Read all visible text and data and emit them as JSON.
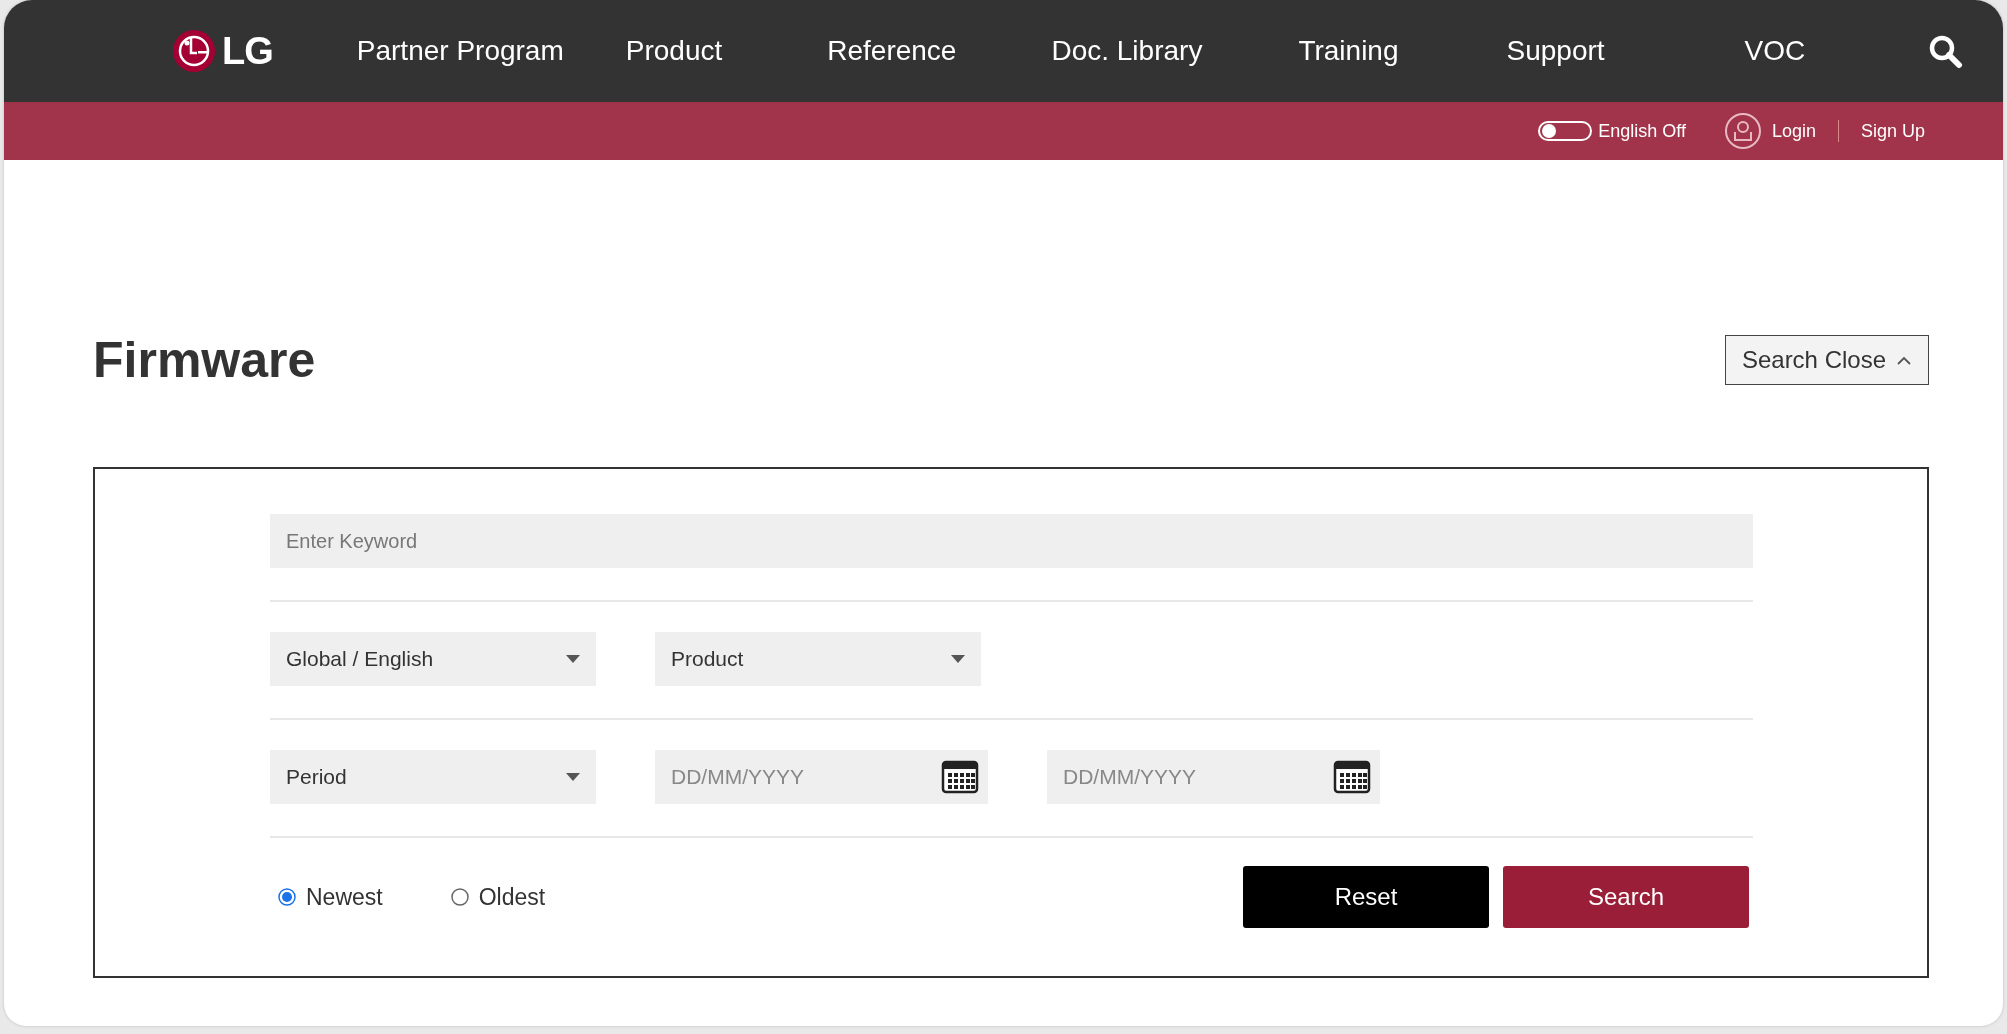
{
  "header": {
    "logo": "LG",
    "nav": [
      {
        "label": "Partner Program"
      },
      {
        "label": "Product"
      },
      {
        "label": "Reference"
      },
      {
        "label": "Doc. Library"
      },
      {
        "label": "Training"
      },
      {
        "label": "Support"
      },
      {
        "label": "VOC"
      }
    ]
  },
  "utility_bar": {
    "language_toggle": {
      "label": "English Off",
      "on": false
    },
    "login": "Login",
    "sign_up": "Sign Up"
  },
  "page": {
    "title": "Firmware",
    "search_toggle": "Search Close"
  },
  "search_form": {
    "keyword": {
      "placeholder": "Enter Keyword"
    },
    "rows": [
      [
        {
          "kind": "select",
          "value": "Global / English"
        },
        {
          "kind": "select",
          "value": "Product"
        }
      ],
      [
        {
          "kind": "select",
          "value": "Period"
        },
        {
          "kind": "date",
          "placeholder": "DD/MM/YYYY"
        },
        {
          "kind": "date",
          "placeholder": "DD/MM/YYYY"
        }
      ]
    ],
    "sort": [
      {
        "label": "Newest",
        "selected": true
      },
      {
        "label": "Oldest",
        "selected": false
      }
    ],
    "buttons": [
      {
        "kind": "reset",
        "label": "Reset"
      },
      {
        "kind": "search",
        "label": "Search"
      }
    ]
  }
}
